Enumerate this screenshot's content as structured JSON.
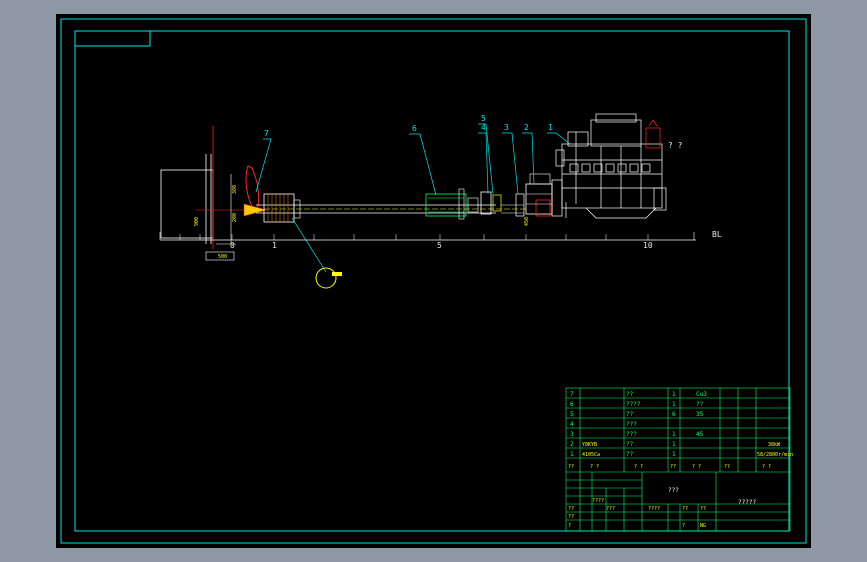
{
  "colors": {
    "background": "#000000",
    "outer_frame": "#8e98a4",
    "border": "#00e5e5",
    "geometry": "#ffffff",
    "leaders": "#00e5e5",
    "dimensions": "#00ff00",
    "highlight": "#ff2020",
    "cursor": "#ffff00"
  },
  "part_labels": [
    {
      "id": "part-7",
      "text": "7"
    },
    {
      "id": "part-6",
      "text": "6"
    },
    {
      "id": "part-5",
      "text": "5"
    },
    {
      "id": "part-4",
      "text": "4"
    },
    {
      "id": "part-3",
      "text": "3"
    },
    {
      "id": "part-2",
      "text": "2"
    },
    {
      "id": "part-1",
      "text": "1"
    }
  ],
  "scale": {
    "ticks": [
      "0",
      "1",
      "5",
      "10"
    ],
    "baseline_label": "BL"
  },
  "engine_note": "? ?",
  "dimension_texts": {
    "left_height": "900",
    "shaft_height": "380",
    "hub_height": "200",
    "bottom_offset": "500",
    "flange_height": "450"
  },
  "title_block": {
    "rows": [
      {
        "no": "7",
        "code": "",
        "name": "??",
        "qty": "1",
        "material": "Cu3",
        "note": ""
      },
      {
        "no": "6",
        "code": "",
        "name": "????",
        "qty": "1",
        "material": "??",
        "note": ""
      },
      {
        "no": "5",
        "code": "",
        "name": "??",
        "qty": "6",
        "material": "35",
        "note": ""
      },
      {
        "no": "4",
        "code": "",
        "name": "???",
        "qty": "",
        "material": "",
        "note": ""
      },
      {
        "no": "3",
        "code": "",
        "name": "???",
        "qty": "1",
        "material": "45",
        "note": ""
      },
      {
        "no": "2",
        "code": "Y8KYB",
        "name": "??",
        "qty": "1",
        "material": "",
        "note": "38kW"
      },
      {
        "no": "1",
        "code": "4105Ca",
        "name": "??",
        "qty": "1",
        "material": "",
        "note": "58/2800r/min"
      }
    ],
    "header": [
      "??",
      "? ?",
      "? ?",
      "??",
      "? ?",
      "??",
      "? ?"
    ],
    "project_title": "???",
    "drawing_name": "?????",
    "sign_cells": [
      "??",
      "????",
      "???",
      "??",
      "????",
      "??",
      "??",
      "?",
      "?",
      "NG"
    ]
  }
}
